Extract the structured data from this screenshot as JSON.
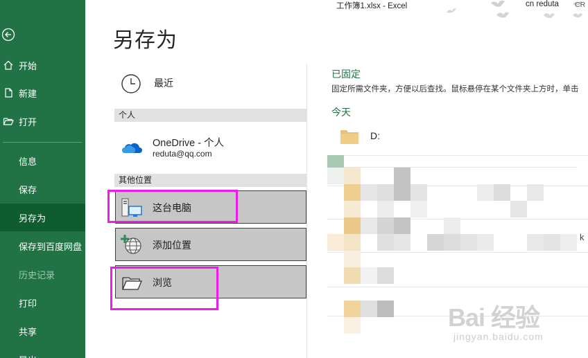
{
  "window": {
    "doc_title": "工作簿1.xlsx  -  Excel",
    "user_name": "cn reduta",
    "user_initials": "CR"
  },
  "sidebar": {
    "items": [
      {
        "label": "开始",
        "icon": "home-icon"
      },
      {
        "label": "新建",
        "icon": "new-document-icon"
      },
      {
        "label": "打开",
        "icon": "open-folder-icon"
      },
      {
        "label": "信息"
      },
      {
        "label": "保存"
      },
      {
        "label": "另存为",
        "selected": true
      },
      {
        "label": "保存到百度网盘"
      },
      {
        "label": "历史记录",
        "disabled": true
      },
      {
        "label": "打印"
      },
      {
        "label": "共享"
      },
      {
        "label": "导出"
      }
    ]
  },
  "page": {
    "title": "另存为"
  },
  "locations": {
    "recent": "最近",
    "personal_header": "个人",
    "onedrive_name": "OneDrive - 个人",
    "onedrive_email": "reduta@qq.com",
    "other_header": "其他位置",
    "this_pc": "这台电脑",
    "add_place": "添加位置",
    "browse": "浏览"
  },
  "right_panel": {
    "pinned_title": "已固定",
    "pinned_desc": "固定所需文件夹，方便以后查找。鼠标悬停在某个文件夹上方时，单击",
    "today_title": "今天",
    "folder_d": "D:",
    "edge_text": "k"
  },
  "watermark": {
    "text": "Bai 经验",
    "url": "jingyan.baidu.com"
  },
  "colors": {
    "sidebar_bg": "#217346",
    "sidebar_selected": "#0e5c2f",
    "accent_green": "#217346",
    "highlight_magenta": "#ee1ce4",
    "button_bg": "#c6c6c6"
  }
}
